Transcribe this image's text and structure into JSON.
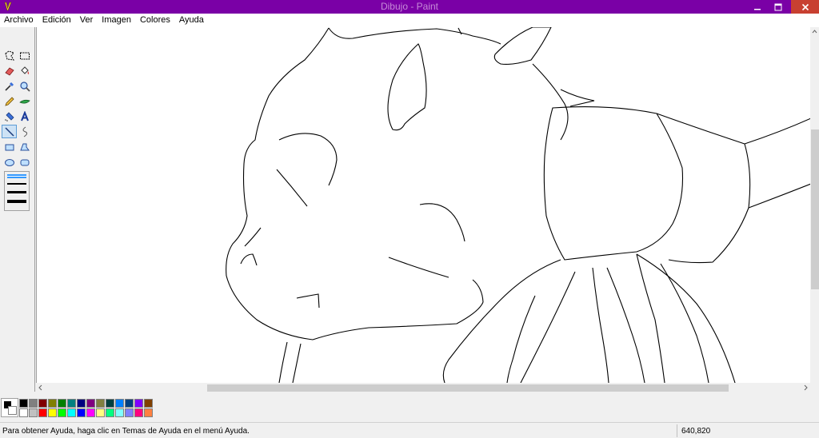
{
  "window": {
    "title": "Dibujo - Paint"
  },
  "menu": {
    "items": [
      "Archivo",
      "Edición",
      "Ver",
      "Imagen",
      "Colores",
      "Ayuda"
    ]
  },
  "toolbox": {
    "tools": [
      {
        "name": "free-select",
        "icon": "free-select-icon"
      },
      {
        "name": "rect-select",
        "icon": "rect-select-icon"
      },
      {
        "name": "eraser",
        "icon": "eraser-icon"
      },
      {
        "name": "fill",
        "icon": "paint-bucket-icon"
      },
      {
        "name": "pick-color",
        "icon": "eyedropper-icon"
      },
      {
        "name": "magnifier",
        "icon": "magnifier-icon"
      },
      {
        "name": "pencil",
        "icon": "pencil-icon"
      },
      {
        "name": "brush",
        "icon": "brush-icon"
      },
      {
        "name": "airbrush",
        "icon": "airbrush-icon"
      },
      {
        "name": "text",
        "icon": "text-icon",
        "glyph": "A"
      },
      {
        "name": "line",
        "icon": "line-icon",
        "selected": true
      },
      {
        "name": "curve",
        "icon": "curve-icon"
      },
      {
        "name": "rectangle",
        "icon": "rectangle-icon"
      },
      {
        "name": "polygon",
        "icon": "polygon-icon"
      },
      {
        "name": "ellipse",
        "icon": "ellipse-icon"
      },
      {
        "name": "rounded-rectangle",
        "icon": "rounded-rectangle-icon"
      }
    ],
    "line_widths": [
      1,
      2,
      3,
      4
    ],
    "selected_line_width": 1
  },
  "palette": {
    "foreground": "#000000",
    "background": "#ffffff",
    "row1": [
      "#000000",
      "#808080",
      "#800000",
      "#808000",
      "#008000",
      "#008080",
      "#000080",
      "#800080",
      "#808040",
      "#004040",
      "#0080ff",
      "#004080",
      "#8000ff",
      "#804000"
    ],
    "row2": [
      "#ffffff",
      "#c0c0c0",
      "#ff0000",
      "#ffff00",
      "#00ff00",
      "#00ffff",
      "#0000ff",
      "#ff00ff",
      "#ffff80",
      "#00ff80",
      "#80ffff",
      "#8080ff",
      "#ff0080",
      "#ff8040"
    ]
  },
  "status": {
    "help_text": "Para obtener Ayuda, haga clic en Temas de Ayuda en el menú Ayuda.",
    "coordinates": "640,820"
  },
  "colors": {
    "titlebar": "#7a00a6",
    "close_button": "#c84031",
    "selection": "#cde2f5"
  }
}
